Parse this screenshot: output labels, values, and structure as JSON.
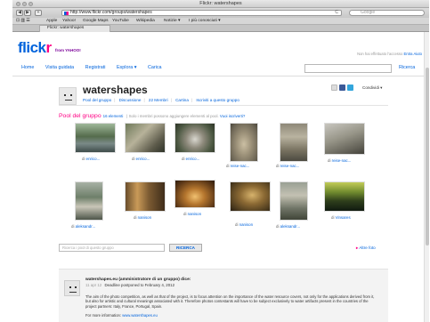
{
  "window": {
    "title": "Flickr: watershapes"
  },
  "toolbar": {
    "back": "◀",
    "forward": "▶",
    "plus": "+",
    "url": "http://www.flickr.com/groups/watershapes",
    "reload": "C",
    "search_placeholder": "Google"
  },
  "bookmarks": [
    "Apple",
    "Yahoo!",
    "Google Maps",
    "YouTube",
    "Wikipedia",
    "Notizie ▾",
    "I più conosciuti ▾"
  ],
  "tab": {
    "label": "Flickr: watershapes"
  },
  "flickr": {
    "logo_part1": "flick",
    "logo_part2": "r",
    "yahoo": "from YAHOO!",
    "signin_text": "Non hai effettuato l'accesso",
    "signin_link": "Entra",
    "help_link": "Aiuto",
    "nav": [
      "Home",
      "Visita guidata",
      "Registrati",
      "Esplora ▾",
      "Carica"
    ],
    "search_button": "Ricerca"
  },
  "group": {
    "name": "watershapes",
    "share_label": "Condividi ▾",
    "subnav": [
      "Pool del gruppo",
      "Discussione",
      "22 Membri",
      "Cartina",
      "Iscriviti a questo gruppo"
    ]
  },
  "pool": {
    "title": "Pool del gruppo",
    "count": "16 elementi",
    "note": "Solo i membri possono aggiungere elementi al pool.",
    "note_link": "Vuoi iscriverti?",
    "search_placeholder": "Ricerca i pool di questo gruppo",
    "search_button": "RICERCA",
    "more": "Altre foto",
    "more_arrow": "▸",
    "photos": [
      {
        "by": "di",
        "author": "enrico..."
      },
      {
        "by": "di",
        "author": "enrico..."
      },
      {
        "by": "di",
        "author": "enrico..."
      },
      {
        "by": "di",
        "author": "reise-nac..."
      },
      {
        "by": "di",
        "author": "reise-nac..."
      },
      {
        "by": "di",
        "author": "reise-nac..."
      },
      {
        "by": "di",
        "author": "aleksandr..."
      },
      {
        "by": "di",
        "author": "nanison"
      },
      {
        "by": "di",
        "author": "nanison"
      },
      {
        "by": "di",
        "author": "nanison"
      },
      {
        "by": "di",
        "author": "aleksandr..."
      },
      {
        "by": "di",
        "author": "Vinsares"
      }
    ]
  },
  "discussion": {
    "author": "watershapes.eu (amministratore di un gruppo) dice:",
    "date": "11 apr 12",
    "subject": "Deadline postponed to February 4, 2012",
    "body": "The aim of the photo competition, as well as that of the project, is to focus attention on the importance of the water resource covers, not only for the applications derived from it, but also for artistic and cultural meanings associated with it. Therefore photos contestants will have to be subject exclusively to water artifacts present in the countries of the project partners: Italy, France, Portugal, Spain.",
    "info_label": "For more information:",
    "info_link": "www.watershapes.eu"
  },
  "colors": {
    "flickr_blue": "#0063dc",
    "flickr_pink": "#ff0084"
  }
}
